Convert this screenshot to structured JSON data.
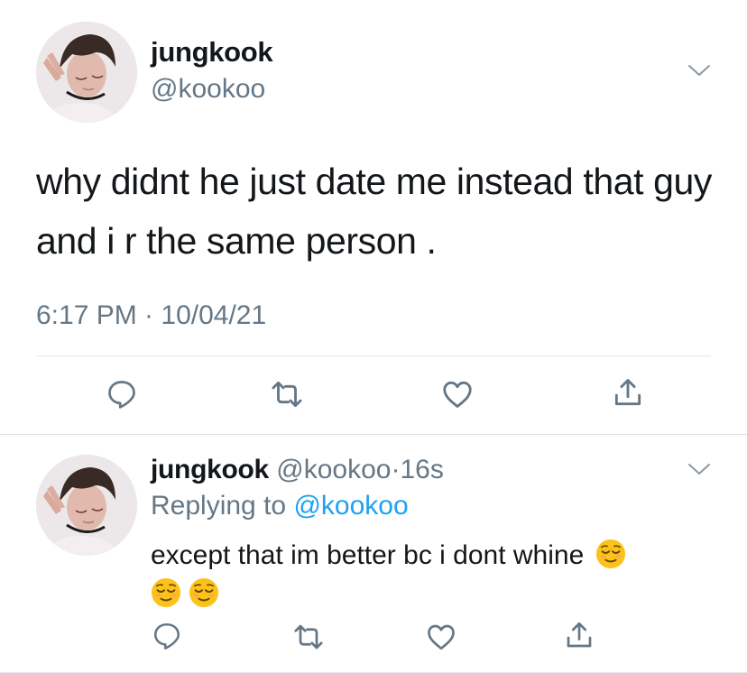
{
  "main_tweet": {
    "display_name": "jungkook",
    "handle": "@kookoo",
    "text": "why didnt he just date me instead that guy and i r the same person .",
    "timestamp": "6:17 PM · 10/04/21",
    "actions": [
      "reply-icon",
      "retweet-icon",
      "like-icon",
      "share-icon"
    ]
  },
  "reply_tweet": {
    "display_name": "jungkook",
    "handle": "@kookoo",
    "separator": "·",
    "time": "16s",
    "replying_prefix": "Replying to",
    "replying_handle": "@kookoo",
    "text": "except that im better bc i dont whine",
    "emojis": [
      "relieved-face",
      "relieved-face",
      "relieved-face"
    ],
    "actions": [
      "reply-icon",
      "retweet-icon",
      "like-icon",
      "share-icon"
    ]
  },
  "colors": {
    "text": "#14171a",
    "secondary": "#657786",
    "link": "#1da1f2",
    "divider": "#e1e8ed",
    "emoji_face": "#fcc21b"
  }
}
